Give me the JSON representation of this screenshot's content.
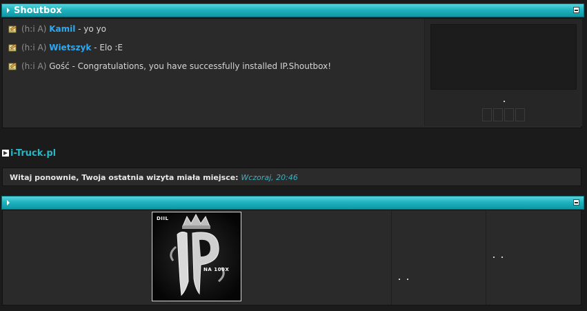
{
  "shoutbox": {
    "title": "Shoutbox",
    "messages": [
      {
        "meta": "(h:i A)",
        "user": "Kamil",
        "text": " - yo yo"
      },
      {
        "meta": "(h:i A)",
        "user": "Wietszyk",
        "text": " - Elo :E"
      },
      {
        "meta": "(h:i A)",
        "user": "Gość",
        "text": " - Congratulations, you have successfully installed IP.Shoutbox!"
      }
    ]
  },
  "site": {
    "name": "i-Truck.pl"
  },
  "welcome": {
    "text": "Witaj ponownie, Twoja ostatnia wizyta miała miejsce: ",
    "date": "Wczoraj, 20:46"
  },
  "logo": {
    "top_left": "DIIL",
    "bottom_right": "NA 100X"
  },
  "colors": {
    "accent": "#1fb3bf",
    "username": "#2ea8f0",
    "panel": "#2a2a2a",
    "background": "#1b1b1b"
  }
}
